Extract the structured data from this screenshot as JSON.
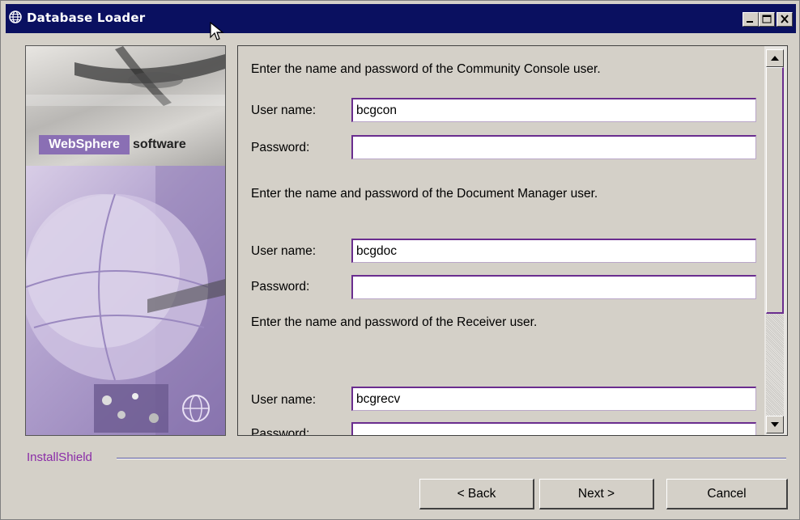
{
  "window": {
    "title": "Database Loader",
    "icon": "globe-icon",
    "title_bar_color": "#0a1060",
    "controls": [
      "minimize-icon",
      "maximize-icon",
      "close-icon"
    ]
  },
  "banner": {
    "brand": "WebSphere",
    "brand_suffix": "software",
    "brand_color": "#8a6fb4"
  },
  "form": {
    "sections": [
      {
        "prompt": "Enter the name and password of the Community Console user.",
        "username_label": "User name:",
        "username_value": "bcgcon",
        "password_label": "Password:",
        "password_value": ""
      },
      {
        "prompt": "Enter the name and password of the Document Manager user.",
        "username_label": "User name:",
        "username_value": "bcgdoc",
        "password_label": "Password:",
        "password_value": ""
      },
      {
        "prompt": "Enter the name and password of the Receiver user.",
        "username_label": "User name:",
        "username_value": "bcgrecv",
        "password_label": "Password:",
        "password_value": ""
      }
    ],
    "field_border_color": "#6a2d8f"
  },
  "footer": {
    "installshield_label": "InstallShield",
    "installshield_color": "#8a2ca8",
    "back_label": "< Back",
    "next_label": "Next >",
    "cancel_label": "Cancel"
  }
}
